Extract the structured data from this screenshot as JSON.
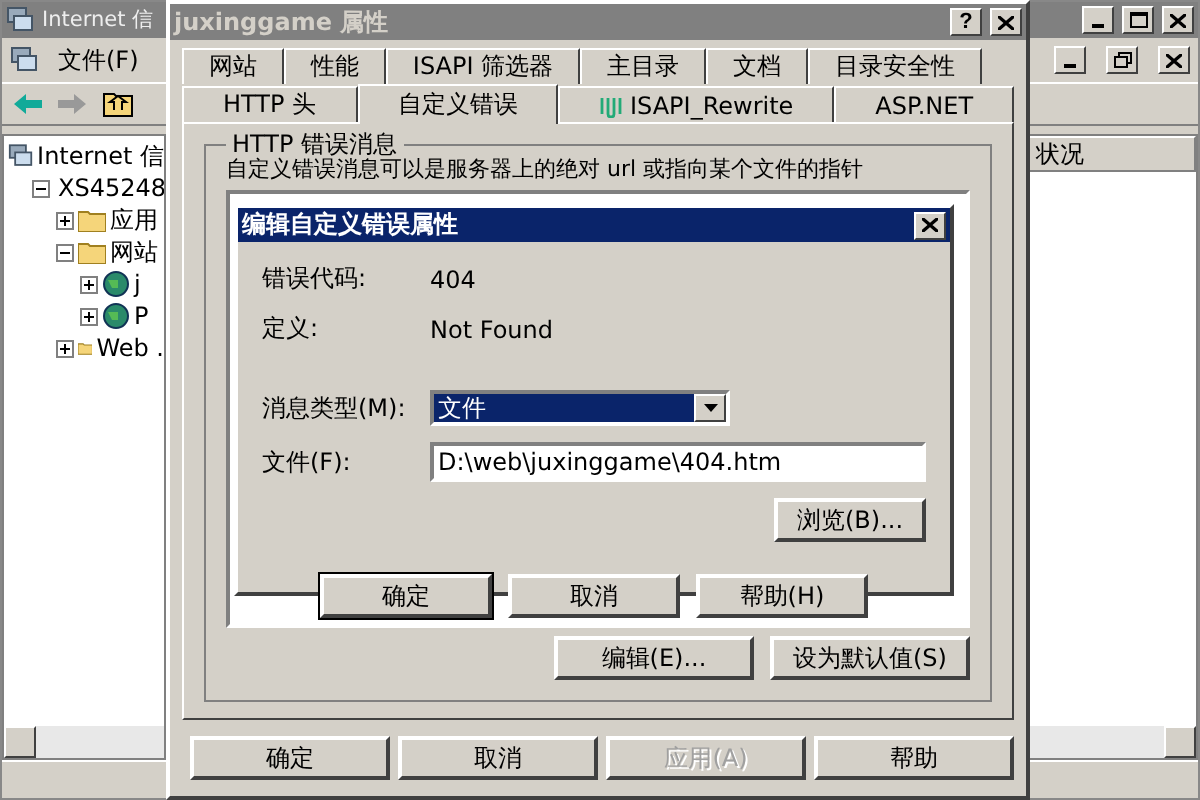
{
  "main_window": {
    "title": "Internet 信",
    "menu": [
      "文件(F)"
    ],
    "tree": [
      {
        "label": "Internet 信",
        "kind": "root",
        "children": [
          {
            "label": "XS45248",
            "kind": "server",
            "expanded": true,
            "children": [
              {
                "label": "应用",
                "kind": "folder",
                "expanded": false
              },
              {
                "label": "网站",
                "kind": "folder",
                "expanded": true,
                "children": [
                  {
                    "label": "j",
                    "kind": "site",
                    "expanded": false
                  },
                  {
                    "label": "P",
                    "kind": "site",
                    "expanded": false
                  }
                ]
              },
              {
                "label": "Web .",
                "kind": "folder",
                "expanded": false
              }
            ]
          }
        ]
      }
    ],
    "columns": [
      "状况"
    ]
  },
  "properties_dialog": {
    "title": "juxinggame 属性",
    "help_button": "?",
    "tab_rows": [
      {
        "tabs": [
          {
            "label": "网站",
            "selected": false,
            "has_icon": false
          },
          {
            "label": "性能",
            "selected": false,
            "has_icon": false
          },
          {
            "label": "ISAPI 筛选器",
            "selected": false,
            "has_icon": false
          },
          {
            "label": "主目录",
            "selected": false,
            "has_icon": false
          },
          {
            "label": "文档",
            "selected": false,
            "has_icon": false
          },
          {
            "label": "目录安全性",
            "selected": false,
            "has_icon": false
          }
        ]
      },
      {
        "tabs": [
          {
            "label": "HTTP 头",
            "selected": false,
            "has_icon": false
          },
          {
            "label": "自定义错误",
            "selected": true,
            "has_icon": false
          },
          {
            "label": "ISAPI_Rewrite",
            "selected": false,
            "has_icon": true
          },
          {
            "label": "ASP.NET",
            "selected": false,
            "has_icon": false
          }
        ]
      }
    ],
    "group_title": "HTTP 错误消息",
    "description": "自定义错误消息可以是服务器上的绝对 url 或指向某个文件的指针",
    "list_buttons": [
      "编辑(E)...",
      "设为默认值(S)"
    ],
    "buttons": [
      {
        "label": "确定",
        "disabled": false
      },
      {
        "label": "取消",
        "disabled": false
      },
      {
        "label": "应用(A)",
        "disabled": true
      },
      {
        "label": "帮助",
        "disabled": false
      }
    ]
  },
  "edit_dialog": {
    "title": "编辑自定义错误属性",
    "error_code_label": "错误代码:",
    "error_code": "404",
    "definition_label": "定义:",
    "definition": "Not Found",
    "message_type_label": "消息类型(M):",
    "message_type": "文件",
    "file_label": "文件(F):",
    "file": "D:\\web\\juxinggame\\404.htm",
    "browse_button": "浏览(B)...",
    "buttons": [
      {
        "label": "确定",
        "default": true
      },
      {
        "label": "取消",
        "default": false
      },
      {
        "label": "帮助(H)",
        "default": false
      }
    ]
  }
}
